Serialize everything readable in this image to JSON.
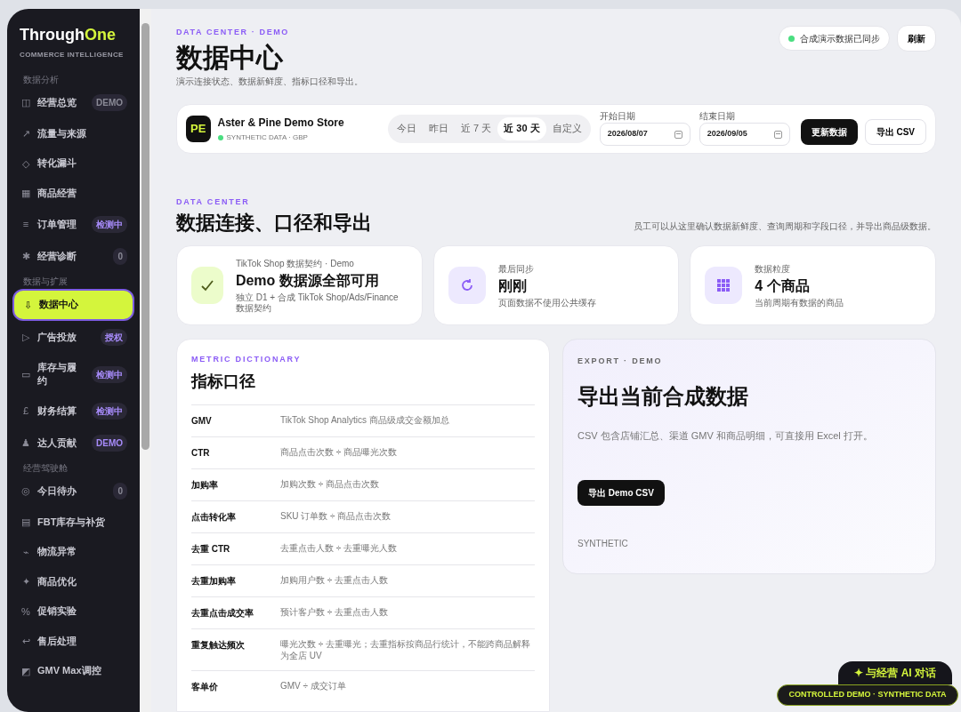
{
  "brand": {
    "name_a": "Through",
    "name_b": "One",
    "tagline": "COMMERCE INTELLIGENCE"
  },
  "sidebar": {
    "groups": [
      {
        "label": "数据分析",
        "items": [
          {
            "icon": "◫",
            "label": "经营总览",
            "badge": {
              "text": "DEMO",
              "color": "#8a8a96"
            },
            "selected": false
          },
          {
            "icon": "↗",
            "label": "流量与来源",
            "selected": false
          },
          {
            "icon": "◇",
            "label": "转化漏斗",
            "selected": false
          },
          {
            "icon": "▦",
            "label": "商品经营",
            "selected": false
          },
          {
            "icon": "≡",
            "label": "订单管理",
            "badge": {
              "text": "检测中",
              "color": "#a78bfa"
            },
            "selected": false
          },
          {
            "icon": "✱",
            "label": "经营诊断",
            "badge": {
              "text": "0",
              "color": "#8a8a96"
            },
            "selected": false
          }
        ]
      },
      {
        "label": "数据与扩展",
        "items": [
          {
            "icon": "⇩",
            "label": "数据中心",
            "selected": true
          },
          {
            "icon": "▷",
            "label": "广告投放",
            "badge": {
              "text": "授权",
              "color": "#a78bfa"
            },
            "selected": false
          },
          {
            "icon": "▭",
            "label": "库存与履约",
            "badge": {
              "text": "检测中",
              "color": "#a78bfa"
            },
            "selected": false
          },
          {
            "icon": "£",
            "label": "财务结算",
            "badge": {
              "text": "检测中",
              "color": "#a78bfa"
            },
            "selected": false
          },
          {
            "icon": "♟",
            "label": "达人贡献",
            "badge": {
              "text": "DEMO",
              "color": "#a78bfa"
            },
            "selected": false
          }
        ]
      },
      {
        "label": "经营驾驶舱",
        "items": [
          {
            "icon": "◎",
            "label": "今日待办",
            "badge": {
              "text": "0",
              "color": "#8a8a96"
            },
            "selected": false
          },
          {
            "icon": "▤",
            "label": "FBT库存与补货",
            "selected": false
          },
          {
            "icon": "⌁",
            "label": "物流异常",
            "selected": false
          },
          {
            "icon": "✦",
            "label": "商品优化",
            "selected": false
          },
          {
            "icon": "%",
            "label": "促销实验",
            "selected": false
          },
          {
            "icon": "↩",
            "label": "售后处理",
            "selected": false
          },
          {
            "icon": "◩",
            "label": "GMV Max调控",
            "selected": false
          }
        ]
      }
    ]
  },
  "header": {
    "eyebrow": "DATA CENTER · DEMO",
    "title": "数据中心",
    "subtitle": "演示连接状态、数据新鲜度、指标口径和导出。",
    "sync_status": "合成演示数据已同步",
    "refresh_button": "刷新"
  },
  "store": {
    "avatar": "PE",
    "name": "Aster & Pine Demo Store",
    "meta": "SYNTHETIC DATA · GBP",
    "ranges": [
      {
        "label": "今日",
        "selected": false
      },
      {
        "label": "昨日",
        "selected": false
      },
      {
        "label": "近 7 天",
        "selected": false
      },
      {
        "label": "近 30 天",
        "selected": true
      },
      {
        "label": "自定义",
        "selected": false
      }
    ],
    "start_label": "开始日期",
    "start_value": "2026/08/07",
    "end_label": "结束日期",
    "end_value": "2026/09/05",
    "update_button": "更新数据",
    "export_button": "导出 CSV"
  },
  "section": {
    "eyebrow": "DATA CENTER",
    "title": "数据连接、口径和导出",
    "note": "员工可以从这里确认数据新鲜度、查询周期和字段口径，并导出商品级数据。"
  },
  "stat_cards": [
    {
      "kind": "check",
      "label": "TikTok Shop 数据契约 · Demo",
      "value": "Demo 数据源全部可用",
      "caption": "独立 D1 + 合成 TikTok Shop/Ads/Finance 数据契约"
    },
    {
      "kind": "sync",
      "label": "最后同步",
      "value": "刚刚",
      "caption": "页面数据不使用公共缓存"
    },
    {
      "kind": "grid",
      "label": "数据粒度",
      "value": "4 个商品",
      "caption": "当前周期有数据的商品"
    }
  ],
  "metric_dictionary": {
    "eyebrow": "METRIC DICTIONARY",
    "title": "指标口径",
    "rows": [
      {
        "metric": "GMV",
        "definition": "TikTok Shop Analytics 商品级成交金额加总"
      },
      {
        "metric": "CTR",
        "definition": "商品点击次数 ÷ 商品曝光次数"
      },
      {
        "metric": "加购率",
        "definition": "加购次数 ÷ 商品点击次数"
      },
      {
        "metric": "点击转化率",
        "definition": "SKU 订单数 ÷ 商品点击次数"
      },
      {
        "metric": "去重 CTR",
        "definition": "去重点击人数 ÷ 去重曝光人数"
      },
      {
        "metric": "去重加购率",
        "definition": "加购用户数 ÷ 去重点击人数"
      },
      {
        "metric": "去重点击成交率",
        "definition": "预计客户数 ÷ 去重点击人数"
      },
      {
        "metric": "重复触达频次",
        "definition": "曝光次数 ÷ 去重曝光；去重指标按商品行统计，不能跨商品解释为全店 UV"
      },
      {
        "metric": "客单价",
        "definition": "GMV ÷ 成交订单"
      }
    ]
  },
  "export_panel": {
    "eyebrow": "EXPORT · DEMO",
    "title": "导出当前合成数据",
    "description": "CSV 包含店铺汇总、渠道 GMV 和商品明细，可直接用 Excel 打开。",
    "button": "导出 Demo CSV",
    "footer": "SYNTHETIC"
  },
  "ai_button": "✦ 与经营 AI 对话",
  "demo_badge": "CONTROLLED DEMO · SYNTHETIC DATA"
}
